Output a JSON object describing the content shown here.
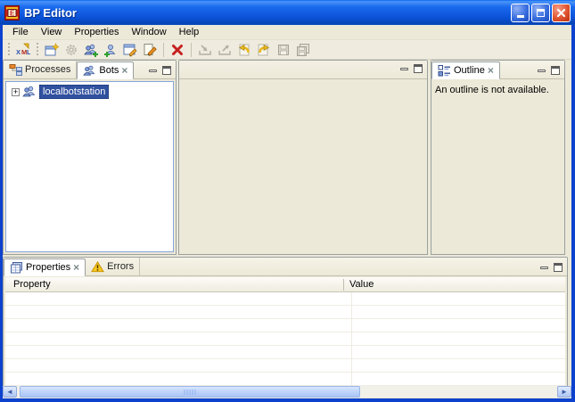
{
  "window": {
    "title": "BP Editor",
    "controls": {
      "minimize": "minimize",
      "maximize": "maximize",
      "close": "close"
    }
  },
  "menu": {
    "items": [
      {
        "label": "File"
      },
      {
        "label": "View"
      },
      {
        "label": "Properties"
      },
      {
        "label": "Window"
      },
      {
        "label": "Help"
      }
    ]
  },
  "toolbar": {
    "buttons": [
      {
        "icon": "new-xml-file-icon",
        "disabled": false
      },
      {
        "icon": "new-wizard-icon",
        "disabled": false
      },
      {
        "icon": "gear-process-icon",
        "disabled": true
      },
      {
        "icon": "add-bots-icon",
        "disabled": false
      },
      {
        "icon": "add-person-icon",
        "disabled": false
      },
      {
        "icon": "edit-window-icon",
        "disabled": false
      },
      {
        "icon": "edit-page-icon",
        "disabled": false
      },
      {
        "icon": "delete-x-icon",
        "disabled": false
      },
      {
        "icon": "import-icon",
        "disabled": true
      },
      {
        "icon": "export-icon",
        "disabled": true
      },
      {
        "icon": "undo-arrow-icon",
        "disabled": false
      },
      {
        "icon": "redo-arrow-icon",
        "disabled": false
      },
      {
        "icon": "save-icon",
        "disabled": true
      },
      {
        "icon": "save-all-icon",
        "disabled": true
      }
    ]
  },
  "left_panel": {
    "tabs": [
      {
        "label": "Processes",
        "active": false
      },
      {
        "label": "Bots",
        "active": true,
        "closable": true
      }
    ],
    "tree": {
      "items": [
        {
          "label": "localbotstation",
          "selected": true,
          "expandable": true
        }
      ]
    }
  },
  "outline_panel": {
    "tab_label": "Outline",
    "message": "An outline is not available."
  },
  "bottom_panel": {
    "tabs": [
      {
        "label": "Properties",
        "active": true,
        "closable": true
      },
      {
        "label": "Errors",
        "active": false
      }
    ],
    "table": {
      "columns": [
        "Property",
        "Value"
      ],
      "rows": []
    }
  },
  "scrollbar": {
    "orientation": "horizontal",
    "left_arrow": "◄",
    "right_arrow": "►"
  },
  "colors": {
    "titlebar_blue": "#0B52D8",
    "frame_blue": "#0D42CE",
    "panel_face": "#ECE9D8",
    "selection_blue": "#30519F",
    "tab_border": "#9AA0A0",
    "warning_yellow": "#F8C820",
    "delete_red": "#CC2020",
    "arrow_yellow": "#E8B820"
  }
}
